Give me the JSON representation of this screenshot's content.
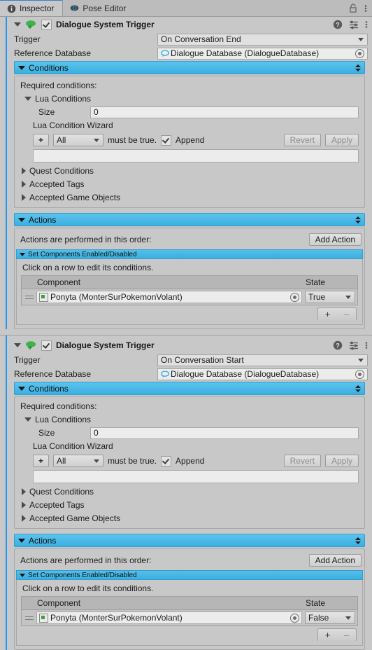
{
  "window": {
    "tabs": [
      {
        "label": "Inspector",
        "icon": "info-icon",
        "active": true
      },
      {
        "label": "Pose Editor",
        "icon": "eye-icon",
        "active": false
      }
    ],
    "lock_icon": "lock-icon",
    "menu_icon": "kebab-menu-icon"
  },
  "shared": {
    "help_icon": "help-icon",
    "preset_icon": "preset-settings-icon",
    "kebab_icon": "kebab-menu-icon",
    "component_icon": "dialogue-system-trigger-icon",
    "conditions_label": "Conditions",
    "required_conditions_label": "Required conditions:",
    "lua_conditions_label": "Lua Conditions",
    "size_label": "Size",
    "size_value": "0",
    "wizard_label": "Lua Condition Wizard",
    "plus_label": "+",
    "minus_label": "–",
    "all_label": "All",
    "must_be_true_label": "must be true.",
    "append_label": "Append",
    "revert_label": "Revert",
    "apply_label": "Apply",
    "quest_conditions_label": "Quest Conditions",
    "accepted_tags_label": "Accepted Tags",
    "accepted_game_objects_label": "Accepted Game Objects",
    "actions_label": "Actions",
    "actions_order_label": "Actions are performed in this order:",
    "add_action_label": "Add Action",
    "set_components_label": "Set Components Enabled/Disabled",
    "click_row_hint": "Click on a row to edit its conditions.",
    "col_component": "Component",
    "col_state": "State",
    "trigger_label": "Trigger",
    "reference_database_label": "Reference Database",
    "accent_blue": "#3ab0e2",
    "selection_blue": "#2196f3",
    "panel_bg": "#c8c8c8"
  },
  "components": [
    {
      "title": "Dialogue System Trigger",
      "enabled": true,
      "trigger_value": "On Conversation End",
      "reference_database_value": "Dialogue Database (DialogueDatabase)",
      "action_rows": [
        {
          "component": "Ponyta (MonterSurPokemonVolant)",
          "state": "True"
        }
      ]
    },
    {
      "title": "Dialogue System Trigger",
      "enabled": true,
      "trigger_value": "On Conversation Start",
      "reference_database_value": "Dialogue Database (DialogueDatabase)",
      "action_rows": [
        {
          "component": "Ponyta (MonterSurPokemonVolant)",
          "state": "False"
        }
      ]
    }
  ]
}
